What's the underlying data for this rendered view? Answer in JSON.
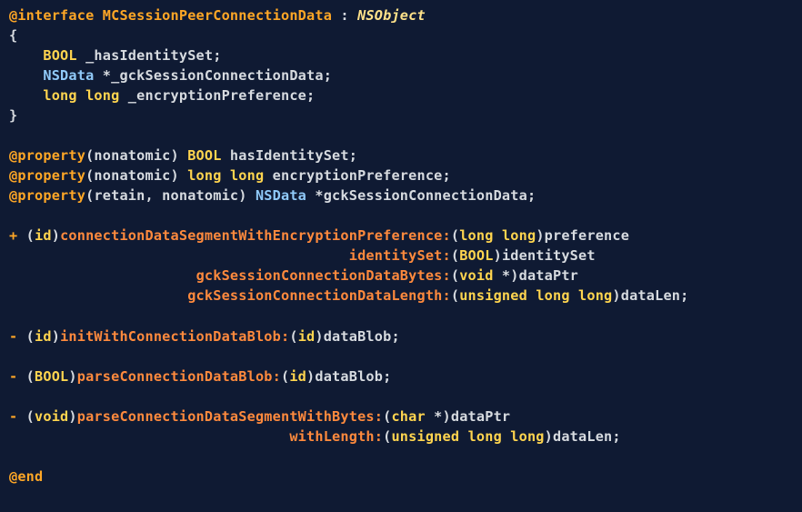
{
  "code": {
    "iface": {
      "kw": "@interface",
      "name": "MCSessionPeerConnectionData",
      "colon": " : ",
      "super": "NSObject"
    },
    "brace_open": "{",
    "ivars": {
      "i1": {
        "indent": "    ",
        "t": "BOOL",
        "rest": " _hasIdentitySet;"
      },
      "i2": {
        "indent": "    ",
        "t": "NSData",
        "rest": " *_gckSessionConnectionData;"
      },
      "i3": {
        "indent": "    ",
        "t1": "long",
        "sp": " ",
        "t2": "long",
        "rest": " _encryptionPreference;"
      }
    },
    "brace_close": "}",
    "props": {
      "p1": {
        "kw": "@property",
        "attrs": "(nonatomic) ",
        "t": "BOOL",
        "rest": " hasIdentitySet;"
      },
      "p2": {
        "kw": "@property",
        "attrs": "(nonatomic) ",
        "t1": "long",
        "sp": " ",
        "t2": "long",
        "rest": " encryptionPreference;"
      },
      "p3": {
        "kw": "@property",
        "attrs": "(retain, nonatomic) ",
        "t": "NSData",
        "rest": " *gckSessionConnectionData;"
      }
    },
    "m1": {
      "l1": {
        "sign": "+",
        "sp": " (",
        "ret": "id",
        "cp": ")",
        "sel": "connectionDataSegmentWithEncryptionPreference:",
        "op": "(",
        "pt1": "long",
        "ps": " ",
        "pt2": "long",
        "cp2": ")",
        "pn": "preference"
      },
      "l2": {
        "indent": "                                        ",
        "sel": "identitySet:",
        "op": "(",
        "pt": "BOOL",
        "cp": ")",
        "pn": "identitySet"
      },
      "l3": {
        "indent": "                      ",
        "sel": "gckSessionConnectionDataBytes:",
        "op": "(",
        "pt": "void",
        "star": " *",
        "cp": ")",
        "pn": "dataPtr"
      },
      "l4": {
        "indent": "                     ",
        "sel": "gckSessionConnectionDataLength:",
        "op": "(",
        "pt1": "unsigned",
        "s1": " ",
        "pt2": "long",
        "s2": " ",
        "pt3": "long",
        "cp": ")",
        "pn": "dataLen;"
      }
    },
    "m2": {
      "sign": "-",
      "sp": " (",
      "ret": "id",
      "cp": ")",
      "sel": "initWithConnectionDataBlob:",
      "op": "(",
      "pt": "id",
      "cp2": ")",
      "pn": "dataBlob;"
    },
    "m3": {
      "sign": "-",
      "sp": " (",
      "ret": "BOOL",
      "cp": ")",
      "sel": "parseConnectionDataBlob:",
      "op": "(",
      "pt": "id",
      "cp2": ")",
      "pn": "dataBlob;"
    },
    "m4": {
      "l1": {
        "sign": "-",
        "sp": " (",
        "ret": "void",
        "cp": ")",
        "sel": "parseConnectionDataSegmentWithBytes:",
        "op": "(",
        "pt": "char",
        "star": " *",
        "cp2": ")",
        "pn": "dataPtr"
      },
      "l2": {
        "indent": "                                 ",
        "sel": "withLength:",
        "op": "(",
        "pt1": "unsigned",
        "s1": " ",
        "pt2": "long",
        "s2": " ",
        "pt3": "long",
        "cp": ")",
        "pn": "dataLen;"
      }
    },
    "end": "@end"
  }
}
